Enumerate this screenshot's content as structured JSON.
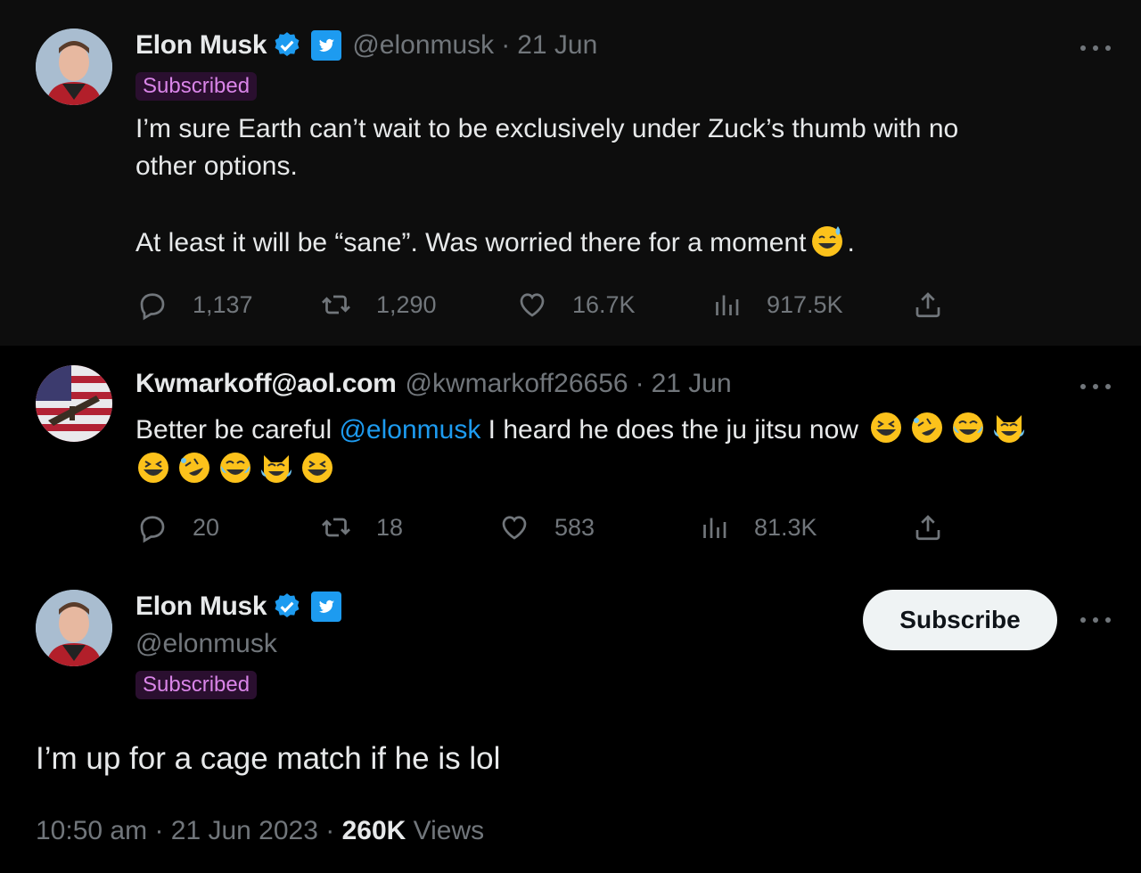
{
  "colors": {
    "accent": "#1d9bf0",
    "subscribed_text": "#d985e8",
    "muted": "#71767b"
  },
  "tweets": [
    {
      "name": "Elon Musk",
      "handle": "@elonmusk",
      "date": "21 Jun",
      "badge": "Subscribed",
      "text_line1": "I’m sure Earth can’t wait to be exclusively under Zuck’s thumb with no",
      "text_line2": "other options.",
      "text_line3": "At least it will be “sane”. Was worried there for a moment",
      "text_line3_end": ".",
      "emoji_icon": "sweat-smile-emoji",
      "replies": "1,137",
      "retweets": "1,290",
      "likes": "16.7K",
      "views": "917.5K"
    },
    {
      "name": "Kwmarkoff@aol.com",
      "handle": "@kwmarkoff26656",
      "date": "21 Jun",
      "text_before": "Better be careful ",
      "mention": "@elonmusk",
      "text_after": " I heard he does the ju jitsu now",
      "emojis": [
        "laughing-emoji",
        "rofl-emoji",
        "joy-emoji",
        "cat-joy-emoji",
        "laughing-emoji",
        "rofl-emoji",
        "joy-emoji",
        "cat-joy-emoji",
        "laughing-emoji"
      ],
      "replies": "20",
      "retweets": "18",
      "likes": "583",
      "views": "81.3K"
    },
    {
      "name": "Elon Musk",
      "handle": "@elonmusk",
      "badge": "Subscribed",
      "subscribe_label": "Subscribe",
      "text": "I’m up for a cage match if he is lol",
      "time": "10:50 am",
      "full_date": "21 Jun 2023",
      "views_count": "260K",
      "views_label": "Views"
    }
  ]
}
